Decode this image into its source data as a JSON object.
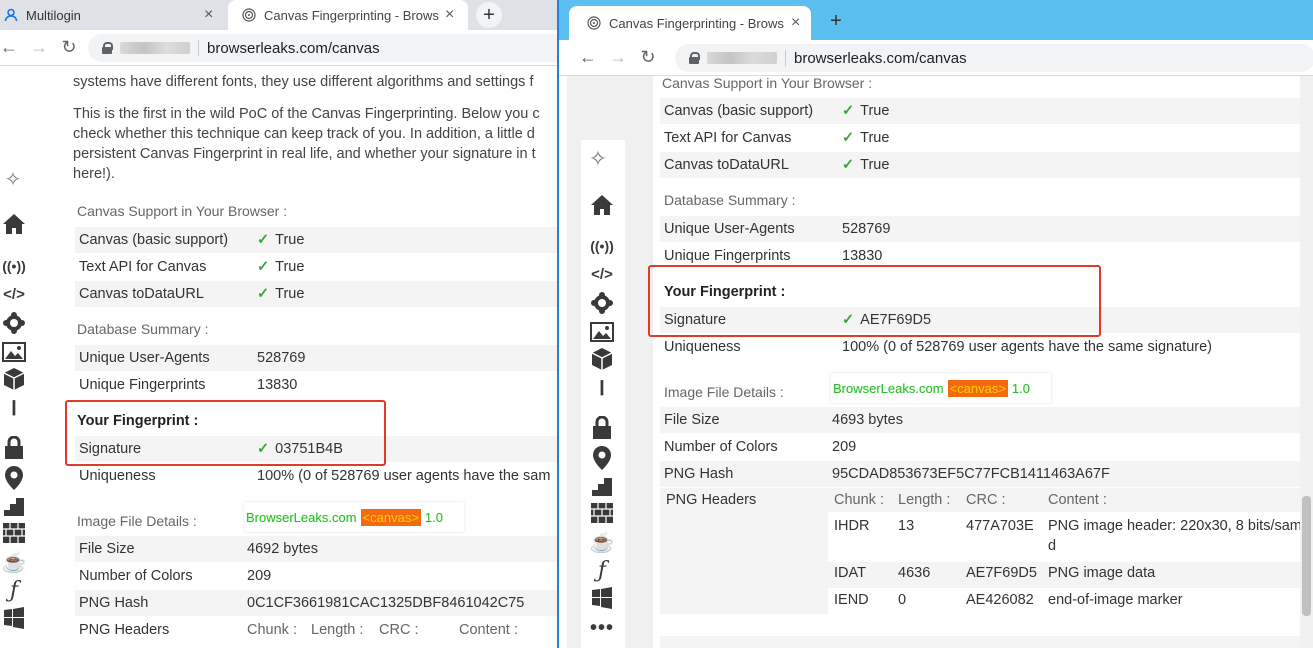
{
  "left_window": {
    "tabs": [
      {
        "label": "Multilogin",
        "icon": "person-icon"
      },
      {
        "label": "Canvas Fingerprinting - Brows",
        "icon": "fingerprint-icon"
      }
    ],
    "url": "browserleaks.com/canvas",
    "intro_lines": [
      "systems have different fonts, they use different algorithms and settings f",
      "This is the first in the wild PoC of the Canvas Fingerprinting. Below you c",
      "check whether this technique can keep track of you. In addition, a little d",
      "persistent Canvas Fingerprint in real life, and whether your signature in t",
      "here!)."
    ],
    "canvas_support": {
      "title": "Canvas Support in Your Browser :",
      "rows": [
        {
          "key": "Canvas (basic support)",
          "value": "True"
        },
        {
          "key": "Text API for Canvas",
          "value": "True"
        },
        {
          "key": "Canvas toDataURL",
          "value": "True"
        }
      ]
    },
    "database": {
      "title": "Database Summary :",
      "rows": [
        {
          "key": "Unique User-Agents",
          "value": "528769"
        },
        {
          "key": "Unique Fingerprints",
          "value": "13830"
        }
      ]
    },
    "fingerprint": {
      "title": "Your Fingerprint :",
      "signature_key": "Signature",
      "signature_value": "03751B4B",
      "uniqueness_key": "Uniqueness",
      "uniqueness_value": "100% (0 of 528769 user agents have the sam"
    },
    "image_details": {
      "title": "Image File Details :",
      "canvas_text_1": "BrowserLeaks.com",
      "canvas_tag": "<canvas>",
      "canvas_text_2": "1.0",
      "rows": [
        {
          "key": "File Size",
          "value": "4692 bytes"
        },
        {
          "key": "Number of Colors",
          "value": "209"
        },
        {
          "key": "PNG Hash",
          "value": "0C1CF3661981CAC1325DBF8461042C75"
        },
        {
          "key": "PNG Headers",
          "value": ""
        }
      ],
      "png_headers": [
        "Chunk :",
        "Length :",
        "CRC :",
        "Content :"
      ]
    }
  },
  "right_window": {
    "tabs": [
      {
        "label": "Canvas Fingerprinting - Brows",
        "icon": "fingerprint-icon"
      }
    ],
    "url": "browserleaks.com/canvas",
    "canvas_support": {
      "title": "Canvas Support in Your Browser :",
      "rows": [
        {
          "key": "Canvas (basic support)",
          "value": "True"
        },
        {
          "key": "Text API for Canvas",
          "value": "True"
        },
        {
          "key": "Canvas toDataURL",
          "value": "True"
        }
      ]
    },
    "database": {
      "title": "Database Summary :",
      "rows": [
        {
          "key": "Unique User-Agents",
          "value": "528769"
        },
        {
          "key": "Unique Fingerprints",
          "value": "13830"
        }
      ]
    },
    "fingerprint": {
      "title": "Your Fingerprint :",
      "signature_key": "Signature",
      "signature_value": "AE7F69D5",
      "uniqueness_key": "Uniqueness",
      "uniqueness_value": "100% (0 of 528769 user agents have the same signature)"
    },
    "image_details": {
      "title": "Image File Details :",
      "canvas_text_1": "BrowserLeaks.com",
      "canvas_tag": "<canvas>",
      "canvas_text_2": "1.0",
      "rows": [
        {
          "key": "File Size",
          "value": "4693 bytes"
        },
        {
          "key": "Number of Colors",
          "value": "209"
        },
        {
          "key": "PNG Hash",
          "value": "95CDAD853673EF5C77FCB1411463A67F"
        },
        {
          "key": "PNG Headers",
          "value": ""
        }
      ],
      "png_headers": [
        "Chunk :",
        "Length :",
        "CRC :",
        "Content :"
      ],
      "chunks": [
        {
          "chunk": "IHDR",
          "length": "13",
          "crc": "477A703E",
          "content_1": "PNG image header: 220x30, 8 bits/sam",
          "content_2": "d"
        },
        {
          "chunk": "IDAT",
          "length": "4636",
          "crc": "AE7F69D5",
          "content_1": "PNG image data",
          "content_2": ""
        },
        {
          "chunk": "IEND",
          "length": "0",
          "crc": "AE426082",
          "content_1": "end-of-image marker",
          "content_2": ""
        }
      ]
    }
  },
  "colors": {
    "check": "#3aa53a",
    "highlight_box": "#e03a2a",
    "canvas_tag_bg": "#f26b10"
  }
}
